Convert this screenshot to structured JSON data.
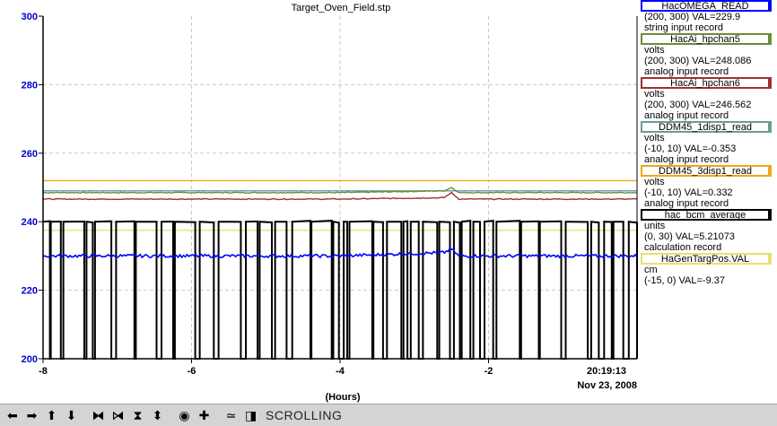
{
  "chart_data": {
    "type": "line",
    "title": "Target_Oven_Field.stp",
    "xlabel": "(Hours)",
    "ylabel": "",
    "xlim": [
      -8,
      0
    ],
    "ylim": [
      200,
      300
    ],
    "x_ticks": [
      "-8",
      "-6",
      "-4",
      "-2"
    ],
    "y_ticks": [
      "200",
      "220",
      "240",
      "260",
      "280",
      "300"
    ],
    "end_time_label": "20:19:13",
    "end_date_label": "Nov 23, 2008",
    "grid": true,
    "legend_position": "right",
    "series": [
      {
        "name": "HacOMEGA_READ",
        "color": "#0000ff",
        "x": [
          -8,
          -6,
          -4,
          -2.6,
          -2.5,
          -2.4,
          0
        ],
        "values": [
          230,
          230,
          230,
          231,
          232,
          230,
          230
        ]
      },
      {
        "name": "HacAi_hpchan5",
        "color": "#6a8c3c",
        "x": [
          -8,
          -4,
          -2.6,
          -2.5,
          -2.4,
          0
        ],
        "values": [
          248.5,
          248.5,
          249,
          250,
          248.5,
          248.5
        ]
      },
      {
        "name": "HacAi_hpchan6",
        "color": "#a03030",
        "x": [
          -8,
          -4,
          -2.6,
          -2.5,
          -2.4,
          0
        ],
        "values": [
          246.6,
          246.6,
          247,
          248.5,
          246.6,
          246.6
        ]
      },
      {
        "name": "DDM45_1disp1_read",
        "color": "#6a9a9a",
        "x": [
          -8,
          0
        ],
        "values": [
          249,
          249
        ]
      },
      {
        "name": "DDM45_3disp1_read",
        "color": "#f0a818",
        "x": [
          -8,
          0
        ],
        "values": [
          252,
          252
        ]
      },
      {
        "name": "hac_bcm_average",
        "color": "#000000",
        "x": [
          -8,
          0
        ],
        "values": [
          240,
          200
        ]
      },
      {
        "name": "HaGenTargPos.VAL",
        "color": "#e8e070",
        "x": [
          -8,
          0
        ],
        "values": [
          237.5,
          237.5
        ]
      }
    ]
  },
  "legend": [
    {
      "name": "HacOMEGA_READ",
      "color": "#0000ff",
      "lines": [
        "(200, 300) VAL=229.9",
        "string input record"
      ]
    },
    {
      "name": "HacAi_hpchan5",
      "color": "#6a8c3c",
      "lines": [
        "volts",
        "(200, 300) VAL=248.086",
        "analog input record"
      ]
    },
    {
      "name": "HacAi_hpchan6",
      "color": "#a03030",
      "lines": [
        "volts",
        "(200, 300) VAL=246.562",
        "analog input record"
      ]
    },
    {
      "name": "DDM45_1disp1_read",
      "color": "#6a9a9a",
      "lines": [
        "volts",
        "(-10, 10) VAL=-0.353",
        "analog input record"
      ]
    },
    {
      "name": "DDM45_3disp1_read",
      "color": "#f0a818",
      "lines": [
        "volts",
        "(-10, 10) VAL=0.332",
        "analog input record"
      ]
    },
    {
      "name": "hac_bcm_average",
      "color": "#000000",
      "lines": [
        "units",
        "(0, 30) VAL=5.21073",
        "calculation record"
      ]
    },
    {
      "name": "HaGenTargPos.VAL",
      "color": "#e8e070",
      "lines": [
        "cm",
        "(-15, 0) VAL=-9.37"
      ]
    }
  ],
  "toolbar": {
    "buttons": [
      {
        "name": "scroll-left-button",
        "icon": "arrow-left-icon",
        "glyph": "➡"
      },
      {
        "name": "scroll-right-button",
        "icon": "arrow-right-icon",
        "glyph": "➡"
      },
      {
        "name": "scroll-up-button",
        "icon": "arrow-up-icon",
        "glyph": "⬆"
      },
      {
        "name": "scroll-down-button",
        "icon": "arrow-down-icon",
        "glyph": "⬇"
      },
      {
        "name": "zoom-in-x-button",
        "icon": "zoom-in-x-icon",
        "glyph": "⧓"
      },
      {
        "name": "zoom-out-x-button",
        "icon": "zoom-out-x-icon",
        "glyph": "⧒"
      },
      {
        "name": "zoom-in-y-button",
        "icon": "zoom-in-y-icon",
        "glyph": "⧗"
      },
      {
        "name": "zoom-out-y-button",
        "icon": "zoom-out-y-icon",
        "glyph": "⬍"
      },
      {
        "name": "reset-button",
        "icon": "target-icon",
        "glyph": "◉"
      },
      {
        "name": "add-button",
        "icon": "plus-icon",
        "glyph": "✚"
      },
      {
        "name": "auto-scale-button",
        "icon": "autoscale-icon",
        "glyph": "≃"
      },
      {
        "name": "scroll-mode-button",
        "icon": "scroll-mode-icon",
        "glyph": "◧"
      }
    ],
    "status": "SCROLLING"
  }
}
